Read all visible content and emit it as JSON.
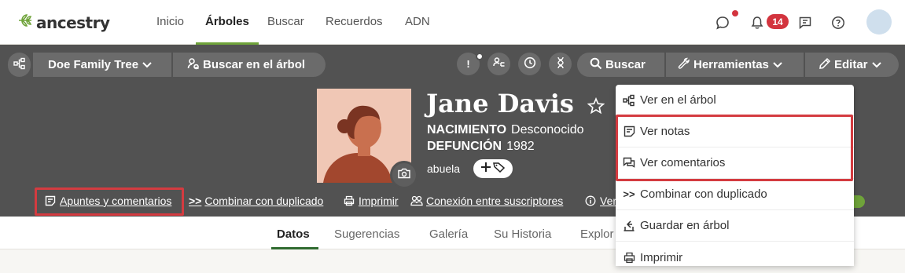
{
  "brand": {
    "name": "ancestry"
  },
  "nav": {
    "items": [
      "Inicio",
      "Árboles",
      "Buscar",
      "Recuerdos",
      "ADN"
    ]
  },
  "notifications": {
    "count": "14"
  },
  "toolbar": {
    "tree_name": "Doe Family Tree",
    "search_tree": "Buscar en el árbol",
    "alert_glyph": "!",
    "search": "Buscar",
    "tools": "Herramientas",
    "edit": "Editar"
  },
  "person": {
    "name": "Jane Davis",
    "birth_label": "NACIMIENTO",
    "birth_value": "Desconocido",
    "death_label": "DEFUNCIÓN",
    "death_value": "1982",
    "relation": "abuela"
  },
  "actions": {
    "notes": "Apuntes y comentarios",
    "merge": "Combinar con duplicado",
    "print": "Imprimir",
    "connection": "Conexión entre suscriptores",
    "more_truncated": "Ver"
  },
  "tabs": [
    "Datos",
    "Sugerencias",
    "Galería",
    "Su Historia",
    "Explor"
  ],
  "tools_menu": {
    "items": [
      "Ver en el árbol",
      "Ver notas",
      "Ver comentarios",
      "Combinar con duplicado",
      "Guardar en árbol",
      "Imprimir"
    ]
  },
  "colors": {
    "accent_green": "#6fa33a",
    "highlight_red": "#d43b40",
    "badge_red": "#d3343e",
    "header_dark": "#525252"
  }
}
